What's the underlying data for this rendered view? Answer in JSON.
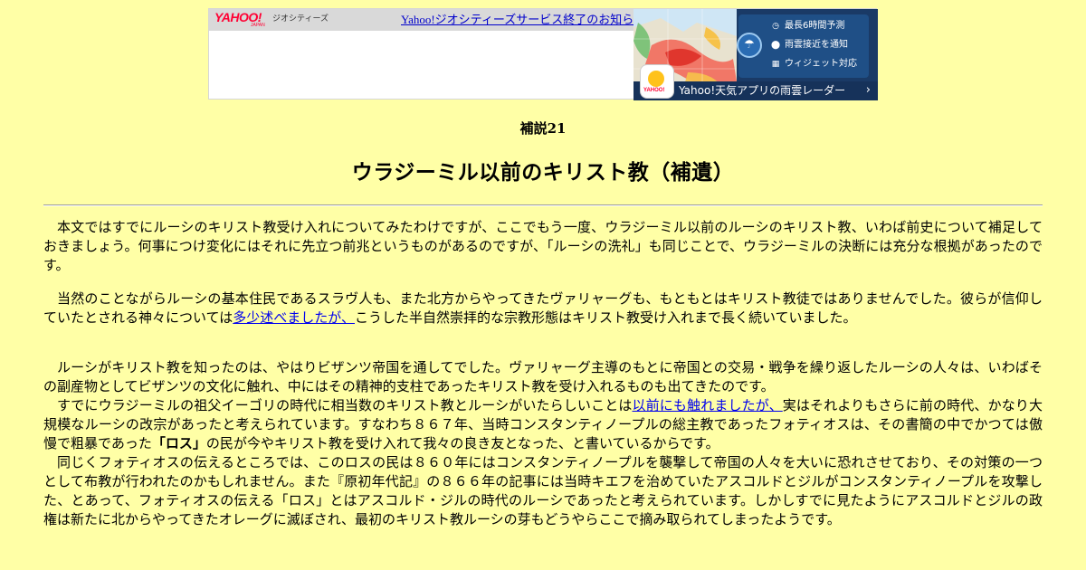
{
  "banner": {
    "logo_text": "YAHOO!",
    "logo_sub": "JAPAN",
    "geocities_label": "ジオシティーズ",
    "notice_link": "Yahoo!ジオシティーズサービス終了のお知らせ"
  },
  "ad": {
    "features": [
      {
        "icon": "clock-icon",
        "label": "最長6時間予測"
      },
      {
        "icon": "pin-icon",
        "label": "雨雲接近を通知"
      },
      {
        "icon": "widget-icon",
        "label": "ウィジェット対応"
      }
    ],
    "app_label": "YAHOO!",
    "footer_text": "Yahoo!天気アプリの雨雲レーダー",
    "colors": {
      "panel": "#1f4f86",
      "footer": "#16325a",
      "sun": "#ffc21a"
    }
  },
  "article": {
    "supplement_label": "補説21",
    "title": "ウラジーミル以前のキリスト教（補遺）",
    "p1": "本文ではすでにルーシのキリスト教受け入れについてみたわけですが、ここでもう一度、ウラジーミル以前のルーシのキリスト教、いわば前史について補足しておきましょう。何事につけ変化にはそれに先立つ前兆というものがあるのですが、「ルーシの洗礼」も同じことで、ウラジーミルの決断には充分な根拠があったのです。",
    "p2_a": "当然のことながらルーシの基本住民であるスラヴ人も、また北方からやってきたヴァリャーグも、もともとはキリスト教徒ではありませんでした。彼らが信仰していたとされる神々については",
    "p2_link": "多少述べましたが、",
    "p2_b": "こうした半自然崇拝的な宗教形態はキリスト教受け入れまで長く続いていました。",
    "p3": "ルーシがキリスト教を知ったのは、やはりビザンツ帝国を通してでした。ヴァリャーグ主導のもとに帝国との交易・戦争を繰り返したルーシの人々は、いわばその副産物としてビザンツの文化に触れ、中にはその精神的支柱であったキリスト教を受け入れるものも出てきたのです。",
    "p4_a": "すでにウラジーミルの祖父イーゴリの時代に相当数のキリスト教とルーシがいたらしいことは",
    "p4_link": "以前にも触れましたが、",
    "p4_b": "実はそれよりもさらに前の時代、かなり大規模なルーシの改宗があったと考えられています。すなわち８６７年、当時コンスタンティノープルの総主教であったフォティオスは、その書簡の中でかつては傲慢で粗暴であった",
    "p4_bold": "「ロス」",
    "p4_c": "の民が今やキリスト教を受け入れて我々の良き友となった、と書いているからです。",
    "p5": "同じくフォティオスの伝えるところでは、このロスの民は８６０年にはコンスタンティノープルを襲撃して帝国の人々を大いに恐れさせており、その対策の一つとして布教が行われたのかもしれません。また『原初年代記』の８６６年の記事には当時キエフを治めていたアスコルドとジルがコンスタンティノープルを攻撃した、とあって、フォティオスの伝える「ロス」とはアスコルド・ジルの時代のルーシであったと考えられています。しかしすでに見たようにアスコルドとジルの政権は新たに北からやってきたオレーグに滅ぼされ、最初のキリスト教ルーシの芽もどうやらここで摘み取られてしまったようです。"
  },
  "colors": {
    "page_background": "#ffffa6",
    "link": "#0000ee"
  }
}
